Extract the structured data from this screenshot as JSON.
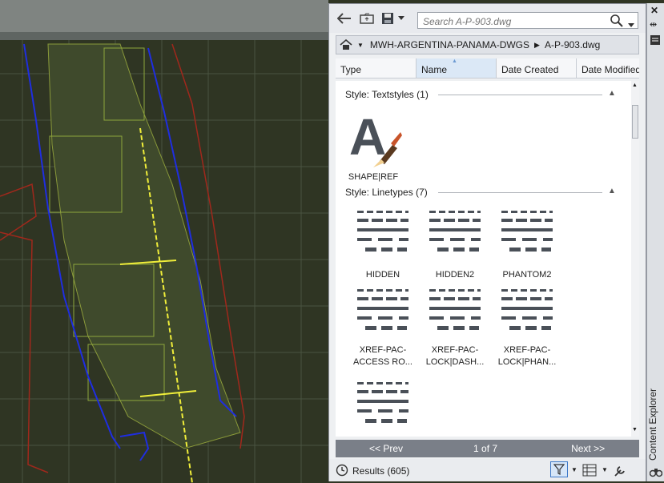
{
  "toolbar": {
    "back_icon": "back-arrow-icon",
    "folder_icon": "folder-up-icon",
    "save_icon": "save-icon",
    "search_placeholder": "Search A-P-903.dwg"
  },
  "breadcrumb": {
    "items": [
      "MWH-ARGENTINA-PANAMA-DWGS",
      "A-P-903.dwg"
    ]
  },
  "columns": [
    "Type",
    "Name",
    "Date Created",
    "Date Modified"
  ],
  "sections": [
    {
      "title": "Style: Textstyles (1)",
      "items": [
        "SHAPE|REF"
      ]
    },
    {
      "title": "Style: Linetypes (7)",
      "items": [
        "HIDDEN",
        "HIDDEN2",
        "PHANTOM2",
        "XREF-PAC-\nACCESS RO...",
        "XREF-PAC-\nLOCK|DASH...",
        "XREF-PAC-\nLOCK|PHAN...",
        ""
      ]
    }
  ],
  "pager": {
    "prev": "<< Prev",
    "page": "1 of 7",
    "next": "Next >>"
  },
  "status": {
    "results": "Results (605)"
  },
  "side": {
    "title": "Content Explorer"
  },
  "colors": {
    "accent": "#3c78c8",
    "pager": "#7a7f88",
    "canvas": "#2f3624"
  }
}
